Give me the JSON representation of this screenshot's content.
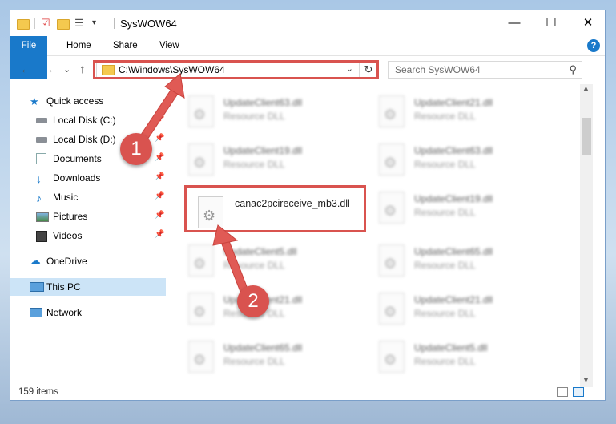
{
  "window": {
    "title": "SysWOW64",
    "controls": {
      "minimize": "—",
      "maximize": "☐",
      "close": "✕"
    }
  },
  "ribbon": {
    "tabs": [
      "File",
      "Home",
      "Share",
      "View"
    ],
    "help": "?"
  },
  "navigation": {
    "back": "←",
    "forward": "→",
    "recent": "⌄",
    "up": "↑",
    "address": "C:\\Windows\\SysWOW64",
    "refresh": "↻",
    "search_placeholder": "Search SysWOW64",
    "search_icon": "⚲"
  },
  "sidebar": {
    "items": [
      {
        "label": "Quick access",
        "icon": "star-icon"
      },
      {
        "label": "Local Disk (C:)",
        "icon": "drive-icon"
      },
      {
        "label": "Local Disk (D:)",
        "icon": "drive-icon"
      },
      {
        "label": "Documents",
        "icon": "documents-icon"
      },
      {
        "label": "Downloads",
        "icon": "downloads-icon"
      },
      {
        "label": "Music",
        "icon": "music-icon"
      },
      {
        "label": "Pictures",
        "icon": "pictures-icon"
      },
      {
        "label": "Videos",
        "icon": "videos-icon"
      },
      {
        "label": "OneDrive",
        "icon": "cloud-icon"
      },
      {
        "label": "This PC",
        "icon": "computer-icon"
      },
      {
        "label": "Network",
        "icon": "network-icon"
      }
    ]
  },
  "files": {
    "type_label": "Resource DLL",
    "col1": [
      "UpdateClient63.dll",
      "UpdateClient19.dll",
      "canac2pcireceive_mb3.dll",
      "UpdateClient5.dll",
      "UpdateClient21.dll",
      "UpdateClient65.dll"
    ],
    "col2": [
      "UpdateClient21.dll",
      "UpdateClient63.dll",
      "UpdateClient19.dll",
      "UpdateClient65.dll",
      "UpdateClient21.dll",
      "UpdateClient5.dll"
    ]
  },
  "status": {
    "count": "159 items"
  },
  "annotations": {
    "step1": "1",
    "step2": "2"
  },
  "colors": {
    "accent": "#1979ca",
    "highlight": "#d9534f"
  }
}
